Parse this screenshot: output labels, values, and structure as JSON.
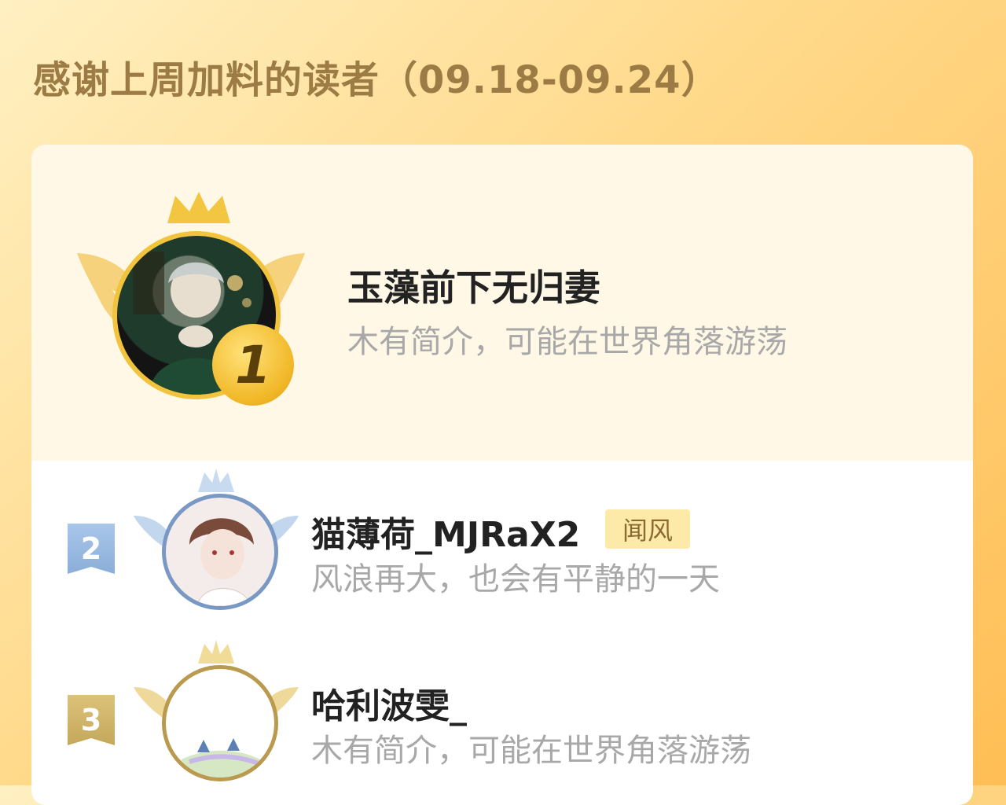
{
  "header": {
    "title": "感谢上周加料的读者（09.18-09.24）"
  },
  "readers": [
    {
      "rank": "1",
      "name": "玉藻前下无归妻",
      "desc": "木有简介，可能在世界角落游荡"
    },
    {
      "rank": "2",
      "name": "猫薄荷_MJRaX2",
      "tag": "闻风",
      "desc": "风浪再大，也会有平静的一天"
    },
    {
      "rank": "3",
      "name": "哈利波雯_",
      "desc": "木有简介，可能在世界角落游荡"
    }
  ],
  "colors": {
    "gold": "#f2b92a",
    "silver": "#9fbde0",
    "bronze": "#cdb160"
  },
  "icons": [
    "crown-icon",
    "wings-icon",
    "rank-ribbon-icon"
  ]
}
